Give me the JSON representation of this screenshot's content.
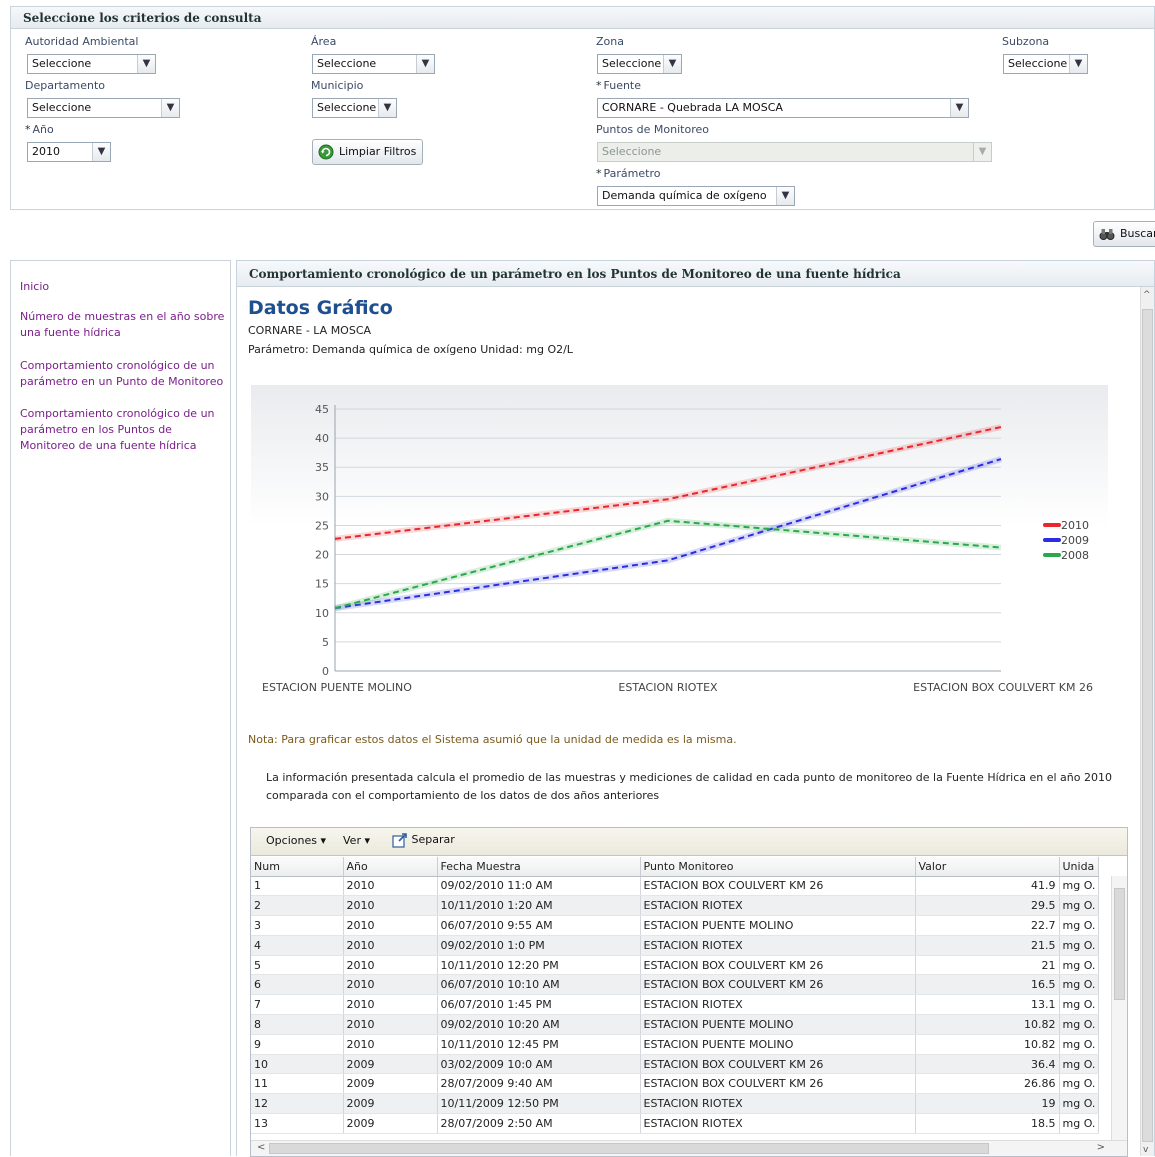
{
  "criteria": {
    "title": "Seleccione los criterios de consulta",
    "autoridad": {
      "label": "Autoridad Ambiental",
      "value": "Seleccione"
    },
    "area": {
      "label": "Área",
      "value": "Seleccione"
    },
    "zona": {
      "label": "Zona",
      "value": "Seleccione"
    },
    "subzona": {
      "label": "Subzona",
      "value": "Seleccione"
    },
    "departamento": {
      "label": "Departamento",
      "value": "Seleccione"
    },
    "municipio": {
      "label": "Municipio",
      "value": "Seleccione"
    },
    "fuente": {
      "label": "Fuente",
      "value": "CORNARE - Quebrada LA MOSCA"
    },
    "anio": {
      "label": "Año",
      "value": "2010"
    },
    "puntos": {
      "label": "Puntos de Monitoreo",
      "value": "Seleccione"
    },
    "parametro": {
      "label": "Parámetro",
      "value": "Demanda química de oxígeno"
    },
    "required_mark": "*",
    "limpiar_label": "Limpiar Filtros",
    "buscar_label": "Buscar"
  },
  "nav": {
    "items": [
      "Inicio",
      "Número de muestras en el año sobre una fuente hídrica",
      "Comportamiento cronológico de un parámetro en un Punto de Monitoreo",
      "Comportamiento cronológico de un parámetro en los Puntos de Monitoreo de una fuente hídrica"
    ]
  },
  "main": {
    "title": "Comportamiento cronológico de un parámetro en los Puntos de Monitoreo de una fuente hídrica",
    "heading": "Datos Gráfico",
    "subtitle1": "CORNARE - LA MOSCA",
    "subtitle2": "Parámetro: Demanda química de oxígeno Unidad: mg O2/L",
    "note": "Nota: Para graficar estos datos el Sistema asumió que la unidad de medida es la misma.",
    "info": "La información presentada calcula el promedio de las muestras y mediciones de calidad en cada punto de monitoreo de la Fuente Hídrica en el año 2010 comparada con el comportamiento de los datos de dos años anteriores",
    "scroll_up": "^",
    "scroll_down": "v"
  },
  "chart_data": {
    "type": "line",
    "categories": [
      "ESTACION PUENTE MOLINO",
      "ESTACION RIOTEX",
      "ESTACION BOX COULVERT KM 26"
    ],
    "series": [
      {
        "name": "2010",
        "values": [
          22.7,
          29.5,
          41.9
        ],
        "color": "#e8262b"
      },
      {
        "name": "2009",
        "values": [
          10.8,
          19,
          36.4
        ],
        "color": "#2a2ee0"
      },
      {
        "name": "2008",
        "values": [
          10.8,
          25.8,
          21.2
        ],
        "color": "#2aa84a"
      }
    ],
    "yticks": [
      0,
      5,
      10,
      15,
      20,
      25,
      30,
      35,
      40,
      45
    ],
    "ylim": [
      0,
      45
    ],
    "line_style": "dashed",
    "legend_position": "right",
    "grid": true
  },
  "table": {
    "toolbar": {
      "opciones": "Opciones ▾",
      "ver": "Ver ▾",
      "separar": "Separar"
    },
    "columns": [
      "Num",
      "Año",
      "Fecha Muestra",
      "Punto Monitoreo",
      "Valor",
      "Unida"
    ],
    "rows": [
      [
        "1",
        "2010",
        "09/02/2010 11:0 AM",
        "ESTACION BOX COULVERT KM 26",
        "41.9",
        "mg O."
      ],
      [
        "2",
        "2010",
        "10/11/2010 1:20 AM",
        "ESTACION RIOTEX",
        "29.5",
        "mg O."
      ],
      [
        "3",
        "2010",
        "06/07/2010 9:55 AM",
        "ESTACION PUENTE MOLINO",
        "22.7",
        "mg O."
      ],
      [
        "4",
        "2010",
        "09/02/2010 1:0 PM",
        "ESTACION RIOTEX",
        "21.5",
        "mg O."
      ],
      [
        "5",
        "2010",
        "10/11/2010 12:20 PM",
        "ESTACION BOX COULVERT KM 26",
        "21",
        "mg O."
      ],
      [
        "6",
        "2010",
        "06/07/2010 10:10 AM",
        "ESTACION BOX COULVERT KM 26",
        "16.5",
        "mg O."
      ],
      [
        "7",
        "2010",
        "06/07/2010 1:45 PM",
        "ESTACION RIOTEX",
        "13.1",
        "mg O."
      ],
      [
        "8",
        "2010",
        "09/02/2010 10:20 AM",
        "ESTACION PUENTE MOLINO",
        "10.82",
        "mg O."
      ],
      [
        "9",
        "2010",
        "10/11/2010 12:45 PM",
        "ESTACION PUENTE MOLINO",
        "10.82",
        "mg O."
      ],
      [
        "10",
        "2009",
        "03/02/2009 10:0 AM",
        "ESTACION BOX COULVERT KM 26",
        "36.4",
        "mg O."
      ],
      [
        "11",
        "2009",
        "28/07/2009 9:40 AM",
        "ESTACION BOX COULVERT KM 26",
        "26.86",
        "mg O."
      ],
      [
        "12",
        "2009",
        "10/11/2009 12:50 PM",
        "ESTACION RIOTEX",
        "19",
        "mg O."
      ],
      [
        "13",
        "2009",
        "28/07/2009 2:50 AM",
        "ESTACION RIOTEX",
        "18.5",
        "mg O."
      ]
    ],
    "scroll_left": "<",
    "scroll_right": ">"
  }
}
